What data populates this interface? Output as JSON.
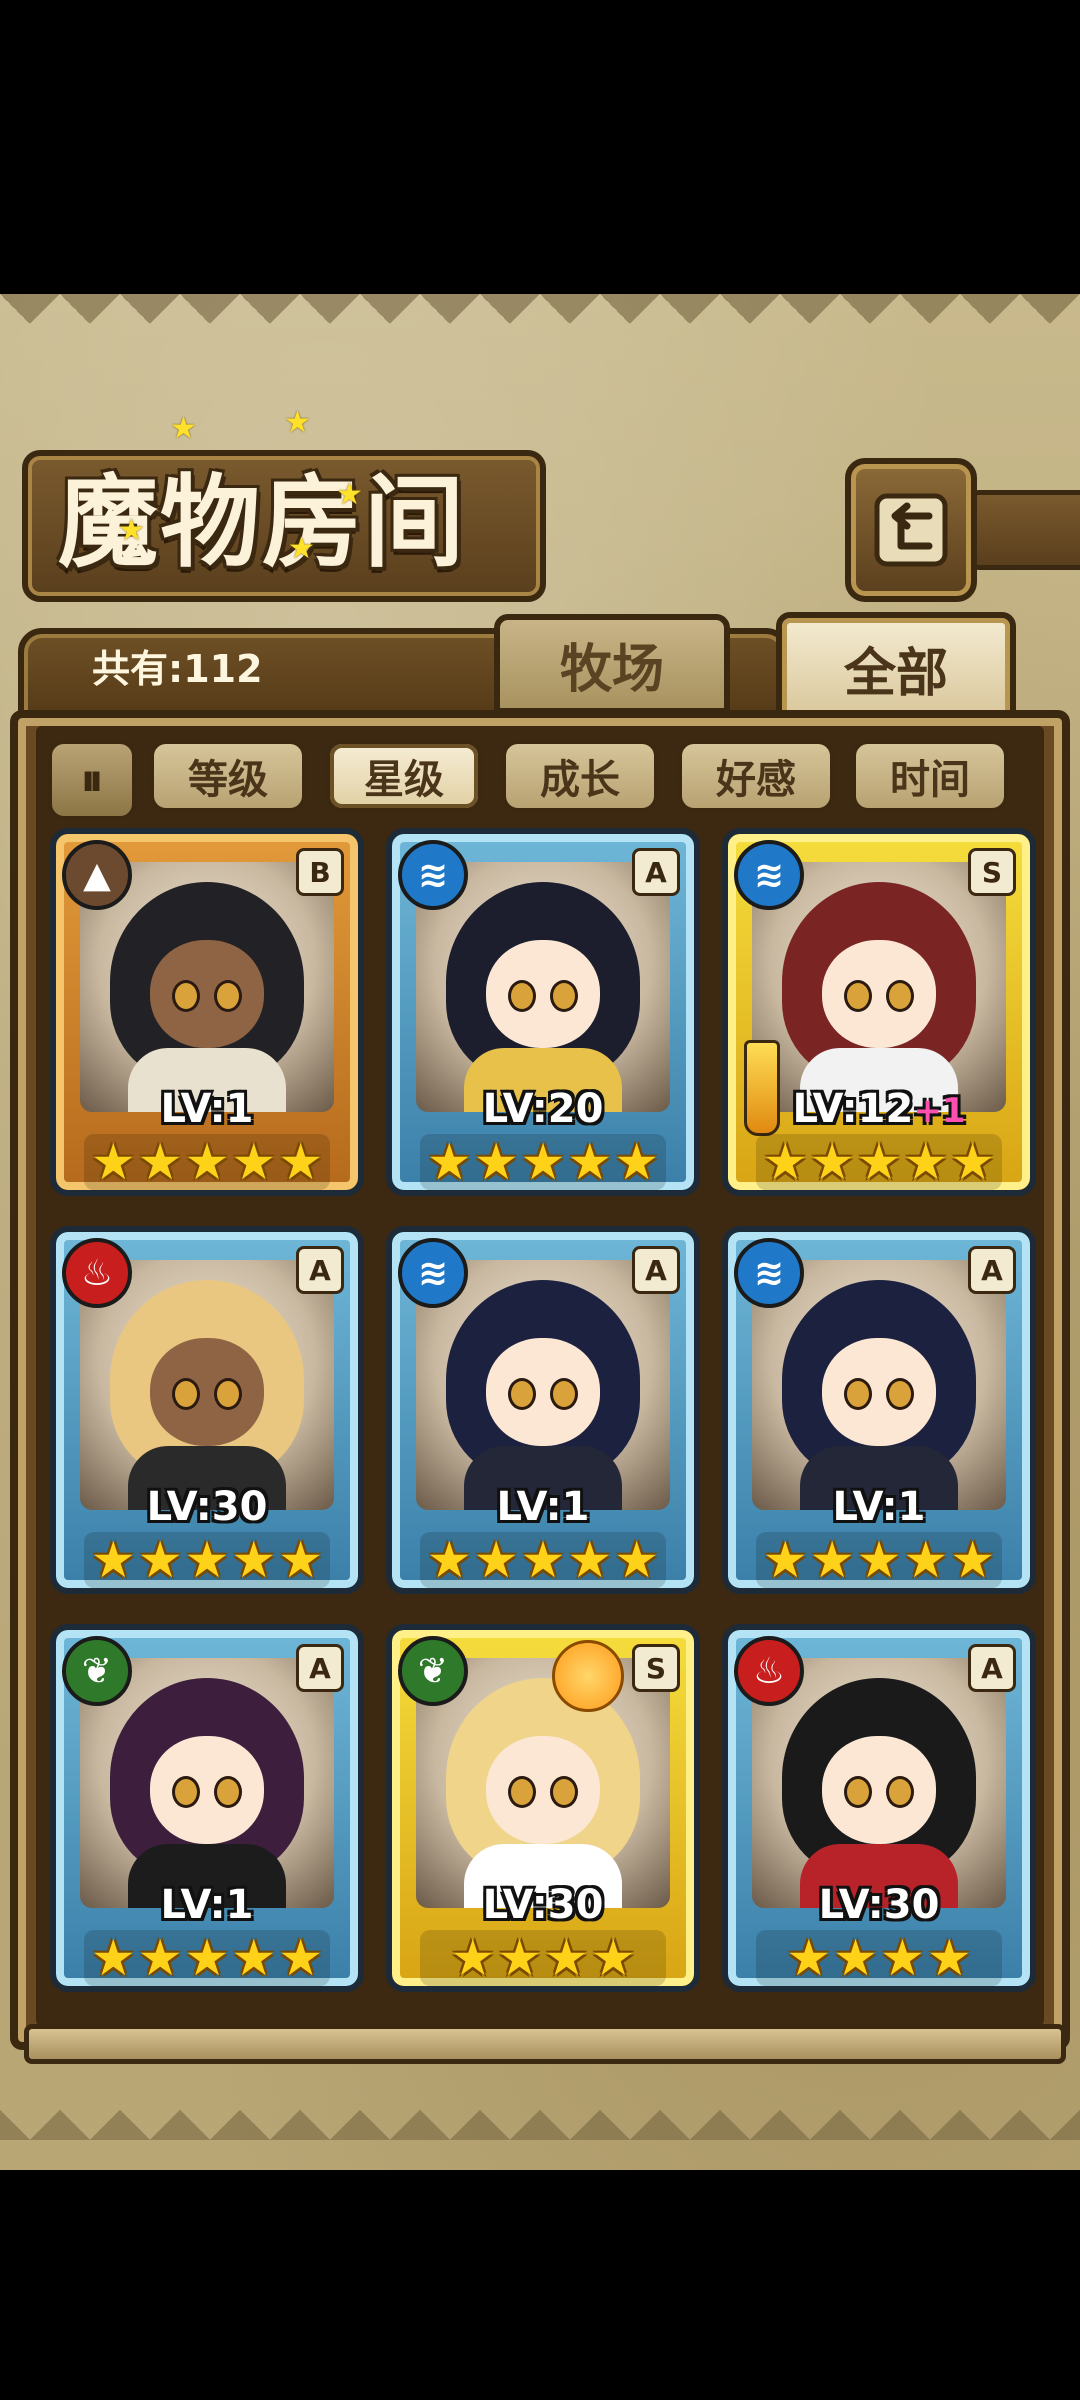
{
  "header": {
    "title": "魔物房间",
    "back_icon": "back-arrow-icon"
  },
  "collection": {
    "count_label": "共有:112"
  },
  "tabs": [
    {
      "label": "牧场",
      "active": false
    },
    {
      "label": "全部",
      "active": true
    }
  ],
  "filters": {
    "toggle_icon": "pause-bars-icon",
    "toggle_glyph": "⏸",
    "items": [
      {
        "label": "等级",
        "active": false
      },
      {
        "label": "星级",
        "active": true
      },
      {
        "label": "成长",
        "active": false
      },
      {
        "label": "好感",
        "active": false
      },
      {
        "label": "时间",
        "active": false
      }
    ]
  },
  "monsters": [
    {
      "element": "earth",
      "element_glyph": "▲",
      "element_color": "#6b4a30",
      "rank": "B",
      "level": "LV:1",
      "bonus": "",
      "stars": 5,
      "frame": "bronze",
      "hair": "#222226",
      "skin": "dark",
      "body": "#e9e1cf"
    },
    {
      "element": "water",
      "element_glyph": "≋",
      "element_color": "#1f78c8",
      "rank": "A",
      "level": "LV:20",
      "bonus": "",
      "stars": 5,
      "frame": "blue",
      "hair": "#1c1e2e",
      "skin": "light",
      "body": "#e8c14a"
    },
    {
      "element": "water",
      "element_glyph": "≋",
      "element_color": "#1f78c8",
      "rank": "S",
      "level": "LV:12",
      "bonus": "+1",
      "stars": 5,
      "frame": "gold",
      "hair": "#7a2524",
      "skin": "light",
      "body": "#f2f2f2"
    },
    {
      "element": "fire",
      "element_glyph": "♨",
      "element_color": "#c81e1e",
      "rank": "A",
      "level": "LV:30",
      "bonus": "",
      "stars": 5,
      "frame": "blue",
      "hair": "#e9c780",
      "skin": "dark",
      "body": "#2a2a2a"
    },
    {
      "element": "water",
      "element_glyph": "≋",
      "element_color": "#1f78c8",
      "rank": "A",
      "level": "LV:1",
      "bonus": "",
      "stars": 5,
      "frame": "blue",
      "hair": "#1d2140",
      "skin": "light",
      "body": "#242738"
    },
    {
      "element": "water",
      "element_glyph": "≋",
      "element_color": "#1f78c8",
      "rank": "A",
      "level": "LV:1",
      "bonus": "",
      "stars": 5,
      "frame": "blue",
      "hair": "#1d2140",
      "skin": "light",
      "body": "#242738"
    },
    {
      "element": "wood",
      "element_glyph": "❦",
      "element_color": "#2f7a2a",
      "rank": "A",
      "level": "LV:1",
      "bonus": "",
      "stars": 5,
      "frame": "blue",
      "hair": "#3d1f3d",
      "skin": "light",
      "body": "#1c1c1c"
    },
    {
      "element": "wood",
      "element_glyph": "❦",
      "element_color": "#2f7a2a",
      "rank": "S",
      "level": "LV:30",
      "bonus": "",
      "stars": 4,
      "frame": "gold",
      "hair": "#f0d48a",
      "skin": "light",
      "body": "#ffffff"
    },
    {
      "element": "fire",
      "element_glyph": "♨",
      "element_color": "#c81e1e",
      "rank": "A",
      "level": "LV:30",
      "bonus": "",
      "stars": 4,
      "frame": "blue",
      "hair": "#1a1a1a",
      "skin": "light",
      "body": "#b8232a"
    }
  ]
}
